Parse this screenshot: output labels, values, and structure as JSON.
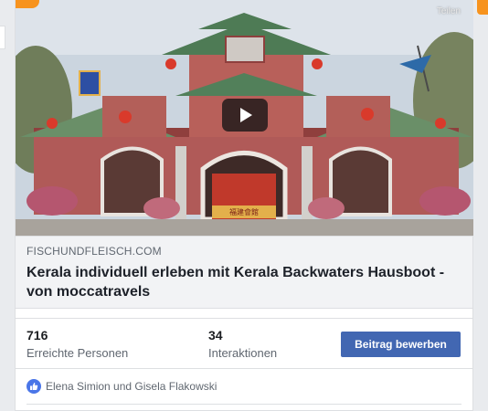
{
  "media": {
    "share_label": "Teilen",
    "sign_text": "福建會館"
  },
  "link": {
    "domain": "FISCHUNDFLEISCH.COM",
    "title": "Kerala individuell erleben mit Kerala Backwaters Hausboot - von moccatravels"
  },
  "stats": {
    "reach_count": "716",
    "reach_label": "Erreichte Personen",
    "interactions_count": "34",
    "interactions_label": "Interaktionen",
    "boost_label": "Beitrag bewerben"
  },
  "reactions": {
    "names": "Elena Simion und Gisela Flakowski"
  },
  "colors": {
    "brand_blue": "#4267b2",
    "accent_orange": "#f7931e",
    "like_blue": "#4a76e8"
  }
}
